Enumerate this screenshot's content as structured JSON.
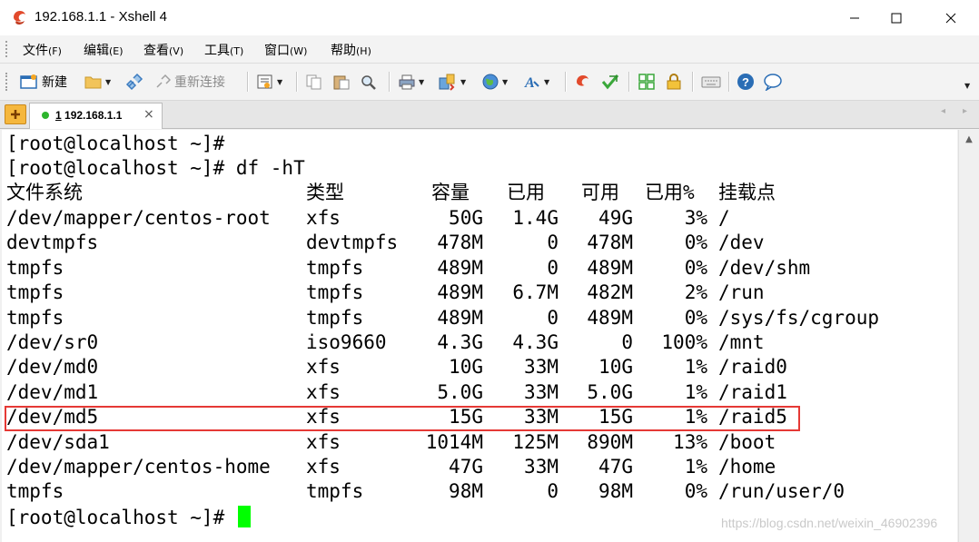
{
  "window": {
    "title": "192.168.1.1 - Xshell 4"
  },
  "menu": [
    {
      "label": "文件",
      "key": "(F)"
    },
    {
      "label": "编辑",
      "key": "(E)"
    },
    {
      "label": "查看",
      "key": "(V)"
    },
    {
      "label": "工具",
      "key": "(T)"
    },
    {
      "label": "窗口",
      "key": "(W)"
    },
    {
      "label": "帮助",
      "key": "(H)"
    }
  ],
  "toolbar": {
    "new_label": "新建",
    "reconnect_label": "重新连接"
  },
  "tabs": [
    {
      "index": "1",
      "label": "192.168.1.1"
    }
  ],
  "terminal": {
    "prompt1": "[root@localhost ~]#",
    "prompt2": "[root@localhost ~]# df -hT",
    "prompt_last": "[root@localhost ~]#",
    "headers": [
      "文件系统",
      "类型",
      "容量",
      "已用",
      "可用",
      "已用%",
      "挂载点"
    ],
    "rows": [
      [
        "/dev/mapper/centos-root",
        "xfs",
        "50G",
        "1.4G",
        "49G",
        "3%",
        "/"
      ],
      [
        "devtmpfs",
        "devtmpfs",
        "478M",
        "0",
        "478M",
        "0%",
        "/dev"
      ],
      [
        "tmpfs",
        "tmpfs",
        "489M",
        "0",
        "489M",
        "0%",
        "/dev/shm"
      ],
      [
        "tmpfs",
        "tmpfs",
        "489M",
        "6.7M",
        "482M",
        "2%",
        "/run"
      ],
      [
        "tmpfs",
        "tmpfs",
        "489M",
        "0",
        "489M",
        "0%",
        "/sys/fs/cgroup"
      ],
      [
        "/dev/sr0",
        "iso9660",
        "4.3G",
        "4.3G",
        "0",
        "100%",
        "/mnt"
      ],
      [
        "/dev/md0",
        "xfs",
        "10G",
        "33M",
        "10G",
        "1%",
        "/raid0"
      ],
      [
        "/dev/md1",
        "xfs",
        "5.0G",
        "33M",
        "5.0G",
        "1%",
        "/raid1"
      ],
      [
        "/dev/md5",
        "xfs",
        "15G",
        "33M",
        "15G",
        "1%",
        "/raid5"
      ],
      [
        "/dev/sda1",
        "xfs",
        "1014M",
        "125M",
        "890M",
        "13%",
        "/boot"
      ],
      [
        "/dev/mapper/centos-home",
        "xfs",
        "47G",
        "33M",
        "47G",
        "1%",
        "/home"
      ],
      [
        "tmpfs",
        "tmpfs",
        "98M",
        "0",
        "98M",
        "0%",
        "/run/user/0"
      ]
    ],
    "highlighted_row": "/dev/md5"
  },
  "watermark": "https://blog.csdn.net/weixin_46902396",
  "colors": {
    "cursor": "#00ff00",
    "highlight_border": "#e53935",
    "tab_add": "#f5b73d"
  }
}
